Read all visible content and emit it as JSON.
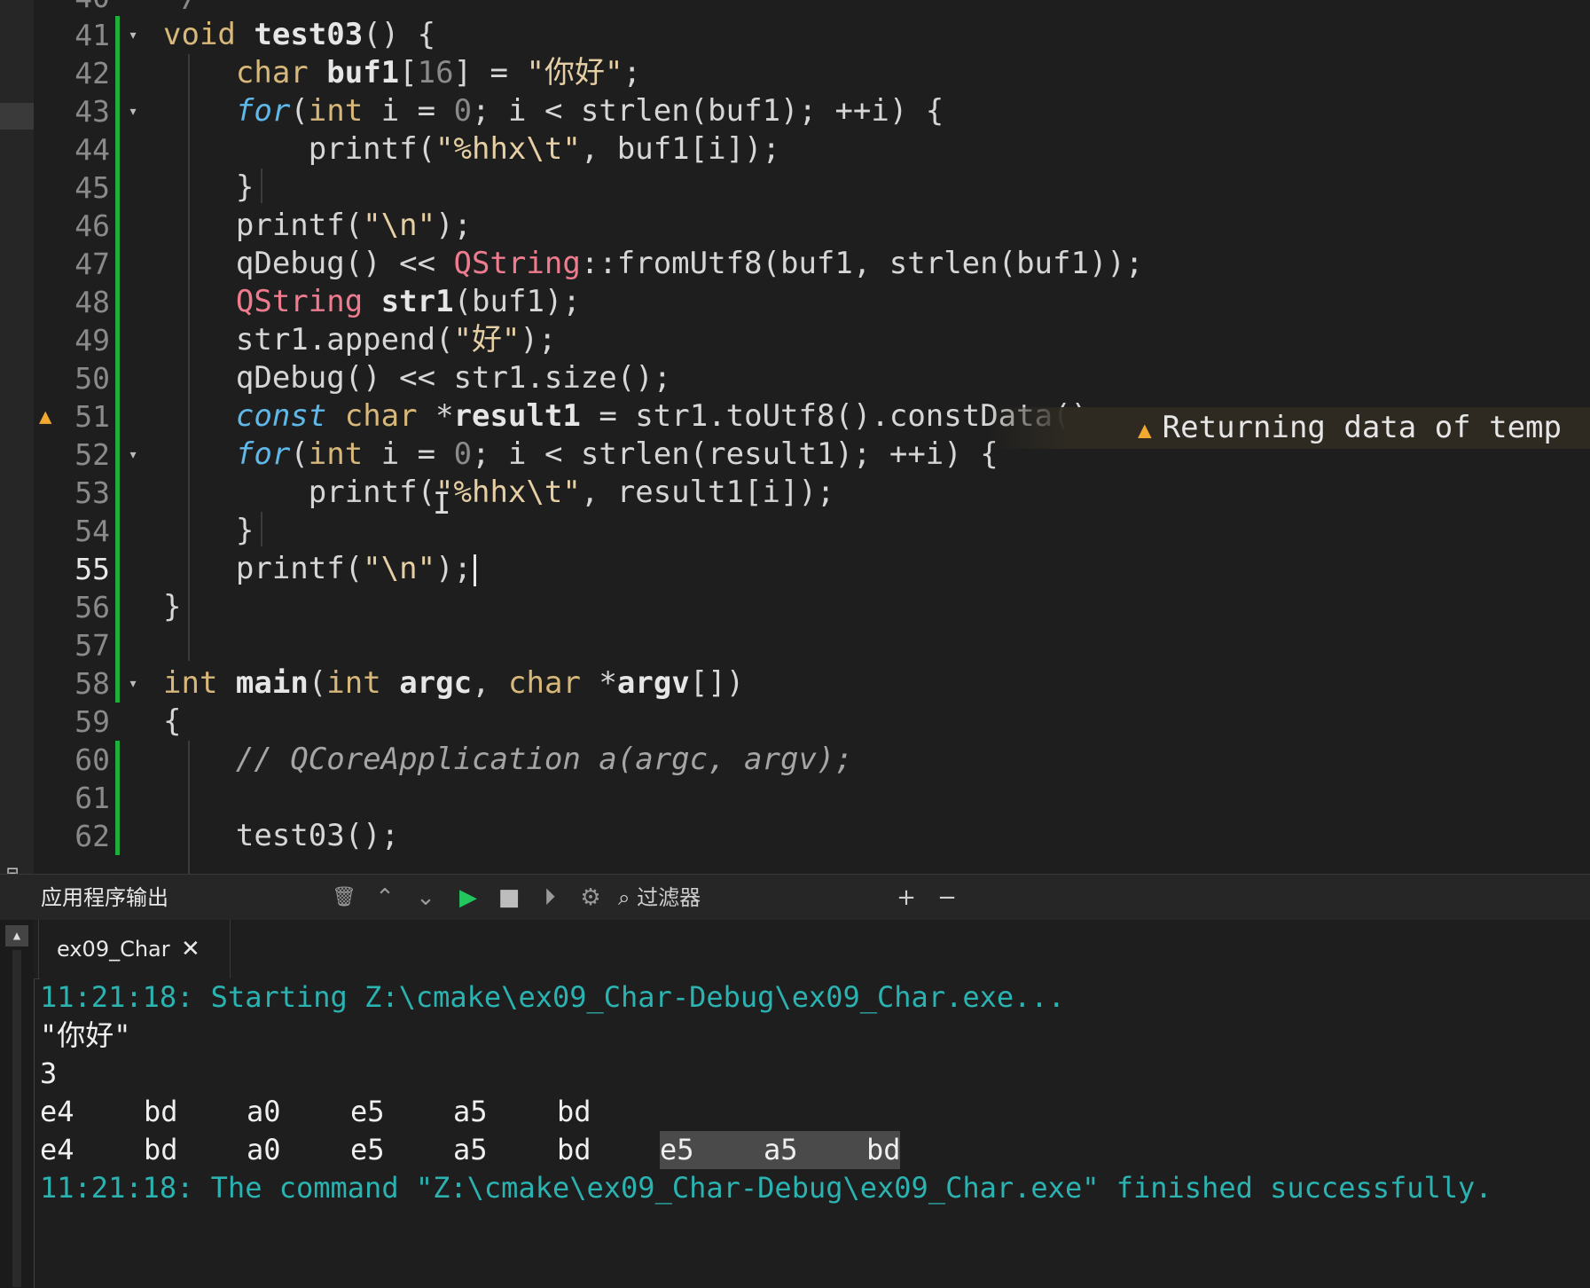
{
  "editor": {
    "top_partial_line_number": "40",
    "top_partial_text": "*/",
    "current_line": "55",
    "lines": [
      {
        "n": "41",
        "tokens": [
          [
            "kw",
            "void"
          ],
          [
            "t",
            " "
          ],
          [
            "b",
            "test03"
          ],
          [
            "t",
            "() {"
          ]
        ]
      },
      {
        "n": "42",
        "tokens": [
          [
            "t",
            "    "
          ],
          [
            "kw",
            "char"
          ],
          [
            "t",
            " "
          ],
          [
            "b",
            "buf1"
          ],
          [
            "t",
            "["
          ],
          [
            "num",
            "16"
          ],
          [
            "t",
            "] = "
          ],
          [
            "str",
            "\"你好\""
          ],
          [
            "t",
            ";"
          ]
        ]
      },
      {
        "n": "43",
        "tokens": [
          [
            "t",
            "    "
          ],
          [
            "it",
            "for"
          ],
          [
            "t",
            "("
          ],
          [
            "kw",
            "int"
          ],
          [
            "t",
            " i = "
          ],
          [
            "num",
            "0"
          ],
          [
            "t",
            "; i < strlen(buf1); ++i) {"
          ]
        ]
      },
      {
        "n": "44",
        "tokens": [
          [
            "t",
            "        printf("
          ],
          [
            "str",
            "\"%hhx\\t\""
          ],
          [
            "t",
            ", buf1[i]);"
          ]
        ]
      },
      {
        "n": "45",
        "tokens": [
          [
            "t",
            "    }"
          ]
        ]
      },
      {
        "n": "46",
        "tokens": [
          [
            "t",
            "    printf("
          ],
          [
            "str",
            "\"\\n\""
          ],
          [
            "t",
            ");"
          ]
        ]
      },
      {
        "n": "47",
        "tokens": [
          [
            "t",
            "    qDebug() << "
          ],
          [
            "ty",
            "QString"
          ],
          [
            "t",
            "::fromUtf8(buf1, strlen(buf1));"
          ]
        ]
      },
      {
        "n": "48",
        "tokens": [
          [
            "t",
            "    "
          ],
          [
            "ty",
            "QString"
          ],
          [
            "t",
            " "
          ],
          [
            "b",
            "str1"
          ],
          [
            "t",
            "(buf1);"
          ]
        ]
      },
      {
        "n": "49",
        "tokens": [
          [
            "t",
            "    str1.append("
          ],
          [
            "str",
            "\"好\""
          ],
          [
            "t",
            ");"
          ]
        ]
      },
      {
        "n": "50",
        "tokens": [
          [
            "t",
            "    qDebug() << str1.size();"
          ]
        ]
      },
      {
        "n": "51",
        "tokens": [
          [
            "t",
            "    "
          ],
          [
            "it",
            "const"
          ],
          [
            "t",
            " "
          ],
          [
            "kw",
            "char"
          ],
          [
            "t",
            " *"
          ],
          [
            "b",
            "result1"
          ],
          [
            "t",
            " = str1.toUtf8().constData();"
          ]
        ]
      },
      {
        "n": "52",
        "tokens": [
          [
            "t",
            "    "
          ],
          [
            "it",
            "for"
          ],
          [
            "t",
            "("
          ],
          [
            "kw",
            "int"
          ],
          [
            "t",
            " i = "
          ],
          [
            "num",
            "0"
          ],
          [
            "t",
            "; i < strlen(result1); ++i) {"
          ]
        ]
      },
      {
        "n": "53",
        "tokens": [
          [
            "t",
            "        printf("
          ],
          [
            "str",
            "\"%hhx\\t\""
          ],
          [
            "t",
            ", result1[i]);"
          ]
        ]
      },
      {
        "n": "54",
        "tokens": [
          [
            "t",
            "    }"
          ]
        ]
      },
      {
        "n": "55",
        "tokens": [
          [
            "t",
            "    printf("
          ],
          [
            "str",
            "\"\\n\""
          ],
          [
            "t",
            ");"
          ]
        ]
      },
      {
        "n": "56",
        "tokens": [
          [
            "t",
            "}"
          ]
        ]
      },
      {
        "n": "57",
        "tokens": []
      },
      {
        "n": "58",
        "tokens": [
          [
            "kw",
            "int"
          ],
          [
            "t",
            " "
          ],
          [
            "b",
            "main"
          ],
          [
            "t",
            "("
          ],
          [
            "kw",
            "int"
          ],
          [
            "t",
            " "
          ],
          [
            "b",
            "argc"
          ],
          [
            "t",
            ", "
          ],
          [
            "kw",
            "char"
          ],
          [
            "t",
            " *"
          ],
          [
            "b",
            "argv"
          ],
          [
            "t",
            "[])"
          ]
        ]
      },
      {
        "n": "59",
        "tokens": [
          [
            "t",
            "{"
          ]
        ]
      },
      {
        "n": "60",
        "tokens": [
          [
            "t",
            "    "
          ],
          [
            "cm",
            "// QCoreApplication a(argc, argv);"
          ]
        ]
      },
      {
        "n": "61",
        "tokens": []
      },
      {
        "n": "62",
        "tokens": [
          [
            "t",
            "    test03();"
          ]
        ]
      }
    ],
    "fold_lines": [
      "41",
      "43",
      "52",
      "58"
    ],
    "warning_line": "51",
    "warning_text": "Returning data of temp",
    "icons": {
      "fold": "chevron-down-icon",
      "warning": "warning-triangle-icon",
      "cursor": "text-cursor-icon"
    }
  },
  "output_pane": {
    "title": "应用程序输出",
    "filter_label": "过滤器",
    "toolbar_icons": [
      "clear-icon",
      "prev-icon",
      "next-icon",
      "run-icon",
      "stop-icon",
      "attach-icon",
      "settings-icon",
      "search-icon",
      "zoom-in-icon",
      "zoom-out-icon"
    ],
    "glyphs": {
      "clear": "🗑",
      "up": "⌃",
      "down": "⌄",
      "run": "▶",
      "stop": "■",
      "attach": "⏵",
      "settings": "⚙",
      "search": "⌕",
      "plus": "+",
      "minus": "−",
      "close": "✕"
    },
    "tab_label": "ex09_Char",
    "start_line": "11:21:18: Starting Z:\\cmake\\ex09_Char-Debug\\ex09_Char.exe...",
    "debug_line": "\"你好\"",
    "size_line": "3",
    "hex_row1": [
      "e4",
      "bd",
      "a0",
      "e5",
      "a5",
      "bd"
    ],
    "hex_row2": [
      "e4",
      "bd",
      "a0",
      "e5",
      "a5",
      "bd",
      "e5",
      "a5",
      "bd"
    ],
    "finish_line": "11:21:18: The command \"Z:\\cmake\\ex09_Char-Debug\\ex09_Char.exe\" finished successfully."
  },
  "colors": {
    "background": "#1e1e1e",
    "keyword": "#d7b87a",
    "italic_keyword": "#5fb8e8",
    "type": "#ee7c8e",
    "string": "#e6cfa4",
    "number": "#8a8a8a",
    "change_bar": "#1fae3c",
    "warning": "#f0a830",
    "system_output": "#2bb3b1"
  }
}
